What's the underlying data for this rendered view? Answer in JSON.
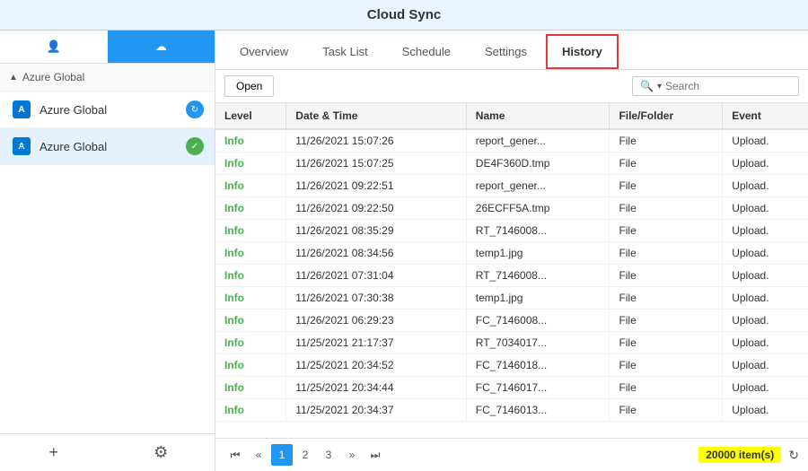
{
  "titleBar": {
    "title": "Cloud Sync"
  },
  "sidebar": {
    "tabs": [
      {
        "id": "user",
        "icon": "👤",
        "active": false
      },
      {
        "id": "cloud",
        "icon": "☁",
        "active": true
      }
    ],
    "groupLabel": "Azure Global",
    "items": [
      {
        "id": "azure-global-1",
        "label": "Azure Global",
        "badgeType": "blue",
        "badgeIcon": "↻",
        "selected": false
      },
      {
        "id": "azure-global-2",
        "label": "Azure Global",
        "badgeType": "green",
        "badgeIcon": "✓",
        "selected": true
      }
    ],
    "footer": {
      "addLabel": "+",
      "settingsLabel": "⚙"
    }
  },
  "content": {
    "tabs": [
      {
        "id": "overview",
        "label": "Overview",
        "active": false
      },
      {
        "id": "tasklist",
        "label": "Task List",
        "active": false
      },
      {
        "id": "schedule",
        "label": "Schedule",
        "active": false
      },
      {
        "id": "settings",
        "label": "Settings",
        "active": false
      },
      {
        "id": "history",
        "label": "History",
        "active": true
      }
    ],
    "toolbar": {
      "openLabel": "Open",
      "searchPlaceholder": "Search",
      "searchDropdownIcon": "▾"
    },
    "table": {
      "columns": [
        "Level",
        "Date & Time",
        "Name",
        "File/Folder",
        "Event"
      ],
      "rows": [
        {
          "level": "Info",
          "datetime": "11/26/2021 15:07:26",
          "name": "report_gener...",
          "fileFolder": "File",
          "event": "Upload."
        },
        {
          "level": "Info",
          "datetime": "11/26/2021 15:07:25",
          "name": "DE4F360D.tmp",
          "fileFolder": "File",
          "event": "Upload."
        },
        {
          "level": "Info",
          "datetime": "11/26/2021 09:22:51",
          "name": "report_gener...",
          "fileFolder": "File",
          "event": "Upload."
        },
        {
          "level": "Info",
          "datetime": "11/26/2021 09:22:50",
          "name": "26ECFF5A.tmp",
          "fileFolder": "File",
          "event": "Upload."
        },
        {
          "level": "Info",
          "datetime": "11/26/2021 08:35:29",
          "name": "RT_7146008...",
          "fileFolder": "File",
          "event": "Upload."
        },
        {
          "level": "Info",
          "datetime": "11/26/2021 08:34:56",
          "name": "temp1.jpg",
          "fileFolder": "File",
          "event": "Upload."
        },
        {
          "level": "Info",
          "datetime": "11/26/2021 07:31:04",
          "name": "RT_7146008...",
          "fileFolder": "File",
          "event": "Upload."
        },
        {
          "level": "Info",
          "datetime": "11/26/2021 07:30:38",
          "name": "temp1.jpg",
          "fileFolder": "File",
          "event": "Upload."
        },
        {
          "level": "Info",
          "datetime": "11/26/2021 06:29:23",
          "name": "FC_7146008...",
          "fileFolder": "File",
          "event": "Upload."
        },
        {
          "level": "Info",
          "datetime": "11/25/2021 21:17:37",
          "name": "RT_7034017...",
          "fileFolder": "File",
          "event": "Upload."
        },
        {
          "level": "Info",
          "datetime": "11/25/2021 20:34:52",
          "name": "FC_7146018...",
          "fileFolder": "File",
          "event": "Upload."
        },
        {
          "level": "Info",
          "datetime": "11/25/2021 20:34:44",
          "name": "FC_7146017...",
          "fileFolder": "File",
          "event": "Upload."
        },
        {
          "level": "Info",
          "datetime": "11/25/2021 20:34:37",
          "name": "FC_7146013...",
          "fileFolder": "File",
          "event": "Upload."
        }
      ]
    },
    "pagination": {
      "firstIcon": "⏮",
      "prevIcon": "«",
      "nextIcon": "»",
      "lastIcon": "⏭",
      "pages": [
        "1",
        "2",
        "3"
      ],
      "activePage": "1",
      "itemsCount": "20000 item(s)",
      "refreshIcon": "↻"
    }
  }
}
